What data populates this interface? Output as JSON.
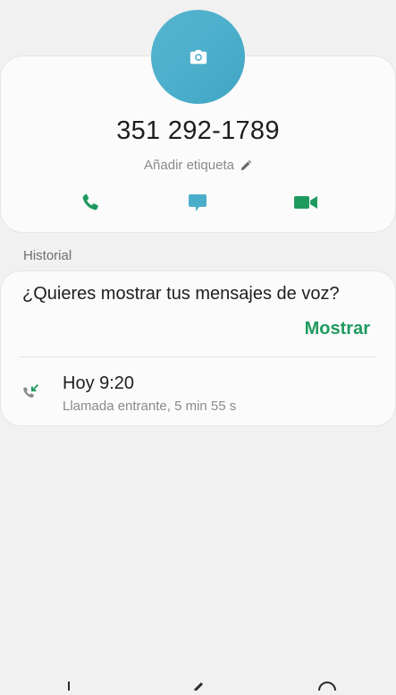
{
  "contact": {
    "avatar_icon": "camera-icon",
    "avatar_color": "#4fb0cc",
    "phone_number": "351 292-1789",
    "add_label_text": "Añadir etiqueta",
    "add_label_icon": "pencil-icon"
  },
  "actions": [
    {
      "name": "call",
      "icon": "phone-icon",
      "color": "#1f9a5f"
    },
    {
      "name": "message",
      "icon": "message-icon",
      "color": "#4aaecb"
    },
    {
      "name": "video-call",
      "icon": "video-icon",
      "color": "#1f9a5f"
    }
  ],
  "history": {
    "section_title": "Historial",
    "voicemail_prompt": "¿Quieres mostrar tus mensajes de voz?",
    "show_button_label": "Mostrar",
    "calls": [
      {
        "time": "Hoy 9:20",
        "detail": "Llamada entrante, 5 min 55 s",
        "icon": "incoming-call-icon"
      }
    ]
  },
  "colors": {
    "accent_green": "#1f9a5f",
    "accent_blue": "#4aaecb",
    "background": "#f1f1f1"
  }
}
